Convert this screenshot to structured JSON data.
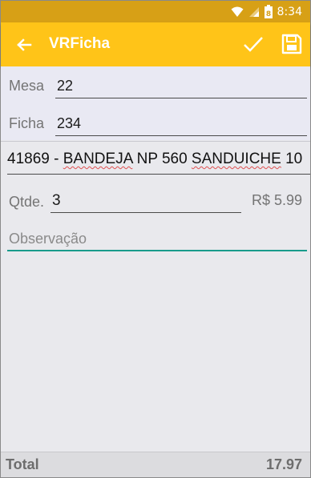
{
  "status_bar": {
    "time": "8:34",
    "battery_level": "8"
  },
  "app_bar": {
    "title": "VRFicha",
    "back_icon": "arrow-left-icon",
    "confirm_icon": "check-icon",
    "save_icon": "floppy-save-icon",
    "color": "#ffc418"
  },
  "form": {
    "mesa_label": "Mesa",
    "mesa_value": "22",
    "ficha_label": "Ficha",
    "ficha_value": "234",
    "product_code": "41869 -",
    "product_word1": "BANDEJA",
    "product_word2": "NP 560",
    "product_word3": "SANDUICHE",
    "product_word4": "10",
    "qty_label": "Qtde.",
    "qty_value": "3",
    "unit_price": "R$ 5.99",
    "observation_placeholder": "Observação",
    "accent_color": "#189b8b"
  },
  "footer": {
    "total_label": "Total",
    "total_value": "17.97"
  }
}
